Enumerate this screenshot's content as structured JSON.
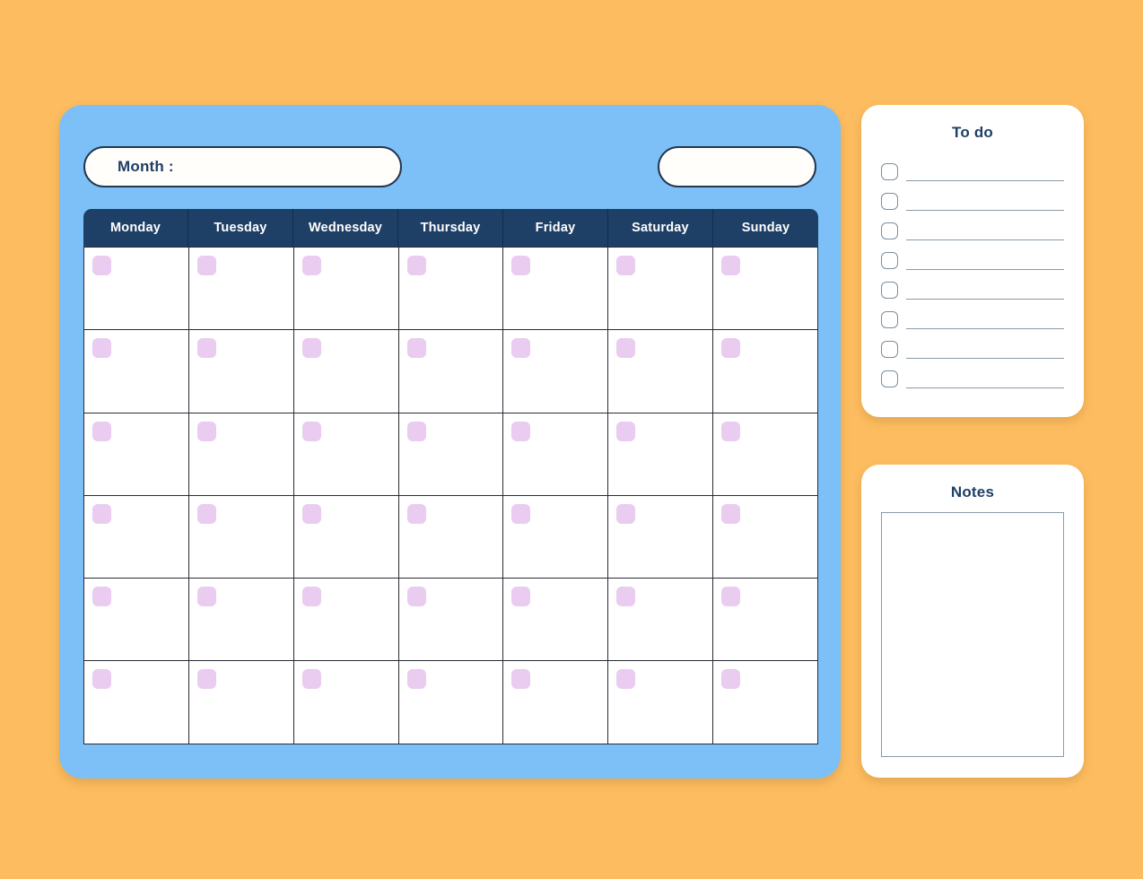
{
  "theme": {
    "page_background": "#fcbc5f",
    "calendar_panel": "#7cc0f7",
    "header_navy": "#1e3f66",
    "day_chip": "#e9ccef",
    "grid_line": "#2a2a35",
    "rule_line": "#8a9ba8",
    "card_white": "#ffffff"
  },
  "calendar": {
    "month_label": "Month :",
    "month_value": "",
    "year_value": "",
    "day_headers": [
      "Monday",
      "Tuesday",
      "Wednesday",
      "Thursday",
      "Friday",
      "Saturday",
      "Sunday"
    ],
    "week_rows": 6,
    "cells": [
      "",
      "",
      "",
      "",
      "",
      "",
      "",
      "",
      "",
      "",
      "",
      "",
      "",
      "",
      "",
      "",
      "",
      "",
      "",
      "",
      "",
      "",
      "",
      "",
      "",
      "",
      "",
      "",
      "",
      "",
      "",
      "",
      "",
      "",
      "",
      "",
      "",
      "",
      "",
      "",
      "",
      ""
    ]
  },
  "todo": {
    "title": "To do",
    "items": [
      "",
      "",
      "",
      "",
      "",
      "",
      "",
      ""
    ]
  },
  "notes": {
    "title": "Notes",
    "content": ""
  }
}
